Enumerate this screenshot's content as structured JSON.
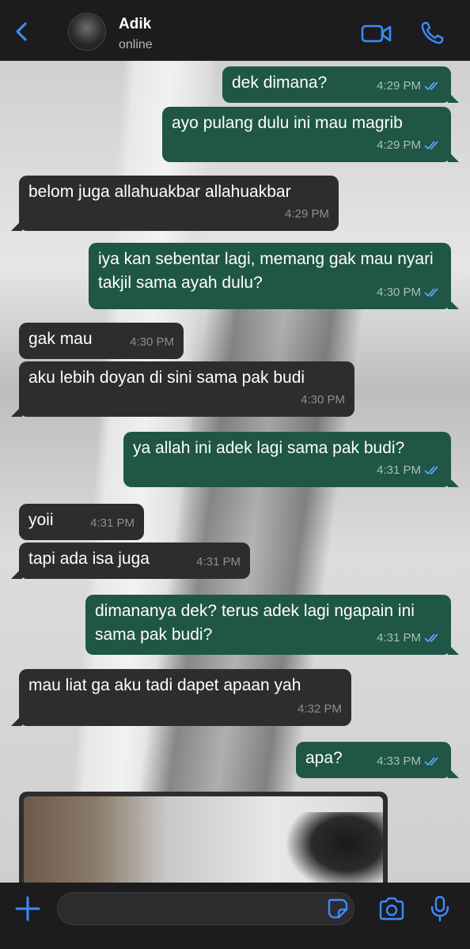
{
  "header": {
    "contact_name": "Adik",
    "contact_status": "online",
    "accent_color": "#3a8cff"
  },
  "messages": [
    {
      "dir": "out",
      "text": "dek dimana?",
      "time": "4:29 PM",
      "read": true
    },
    {
      "dir": "out",
      "text": "ayo pulang dulu ini mau magrib",
      "time": "4:29 PM",
      "read": true
    },
    {
      "dir": "in",
      "text": "belom juga allahuakbar allahuakbar",
      "time": "4:29 PM"
    },
    {
      "dir": "out",
      "text": "iya kan sebentar lagi, memang gak mau nyari takjil sama ayah dulu?",
      "time": "4:30 PM",
      "read": true
    },
    {
      "dir": "in",
      "text": "gak mau",
      "time": "4:30 PM"
    },
    {
      "dir": "in",
      "text": "aku lebih doyan di sini sama pak budi",
      "time": "4:30 PM"
    },
    {
      "dir": "out",
      "text": "ya allah ini adek lagi sama pak budi?",
      "time": "4:31 PM",
      "read": true
    },
    {
      "dir": "in",
      "text": "yoii",
      "time": "4:31 PM"
    },
    {
      "dir": "in",
      "text": "tapi ada isa juga",
      "time": "4:31 PM"
    },
    {
      "dir": "out",
      "text": "dimananya dek? terus adek lagi ngapain ini sama pak budi?",
      "time": "4:31 PM",
      "read": true
    },
    {
      "dir": "in",
      "text": "mau liat ga aku tadi dapet apaan yah",
      "time": "4:32 PM"
    },
    {
      "dir": "out",
      "text": "apa?",
      "time": "4:33 PM",
      "read": true
    }
  ],
  "icons": {
    "back": "chevron-left-icon",
    "video": "video-camera-icon",
    "call": "phone-icon",
    "plus": "plus-icon",
    "sticker": "sticker-icon",
    "camera": "camera-icon",
    "mic": "microphone-icon",
    "read_receipt": "double-check-icon"
  },
  "composer": {
    "value": ""
  }
}
